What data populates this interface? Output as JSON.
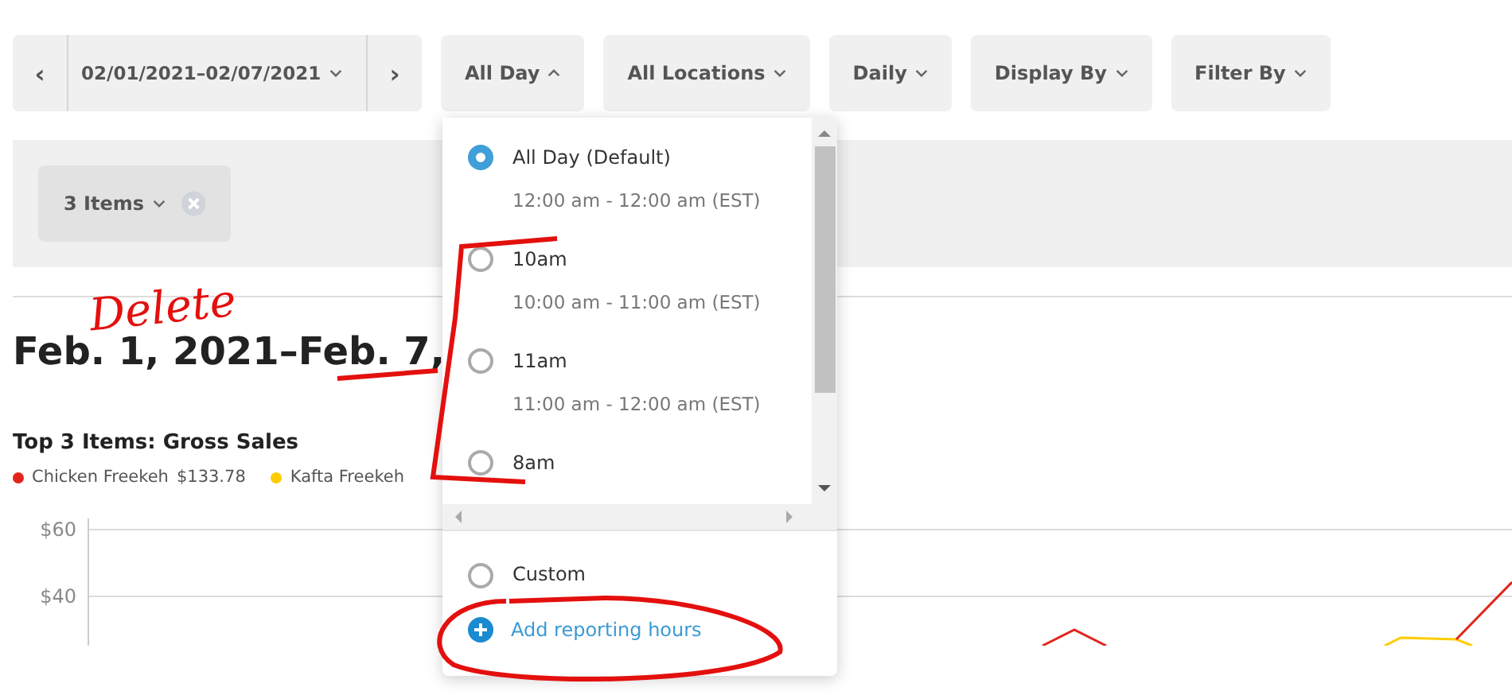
{
  "toolbar": {
    "date_range": {
      "prev": "‹",
      "label": "02/01/2021–02/07/2021",
      "next": "›"
    },
    "filters": [
      {
        "label": "All Day",
        "expanded": true
      },
      {
        "label": "All Locations",
        "expanded": false
      },
      {
        "label": "Daily",
        "expanded": false
      },
      {
        "label": "Display By",
        "expanded": false
      },
      {
        "label": "Filter By",
        "expanded": false
      }
    ]
  },
  "filter_bar": {
    "chips": [
      {
        "label": "3 Items"
      }
    ]
  },
  "heading": "Feb. 1, 2021–Feb. 7,",
  "chart_section": {
    "title": "Top 3 Items: Gross Sales",
    "legend": [
      {
        "name": "Chicken Freekeh",
        "value": "$133.78",
        "color": "#e1251b"
      },
      {
        "name": "Kafta Freekeh",
        "color": "#ffcc00"
      }
    ],
    "y_axis_labels": [
      "$60",
      "$40"
    ]
  },
  "dropdown": {
    "options": [
      {
        "label": "All Day (Default)",
        "time": "12:00 am - 12:00 am (EST)",
        "selected": true
      },
      {
        "label": "10am",
        "time": "10:00 am - 11:00 am (EST)",
        "selected": false
      },
      {
        "label": "11am",
        "time": "11:00 am - 12:00 am (EST)",
        "selected": false
      },
      {
        "label": "8am",
        "selected": false
      }
    ],
    "custom": {
      "label": "Custom",
      "selected": false
    },
    "add_link": "Add reporting hours"
  },
  "annotation": {
    "note": "Delete"
  }
}
